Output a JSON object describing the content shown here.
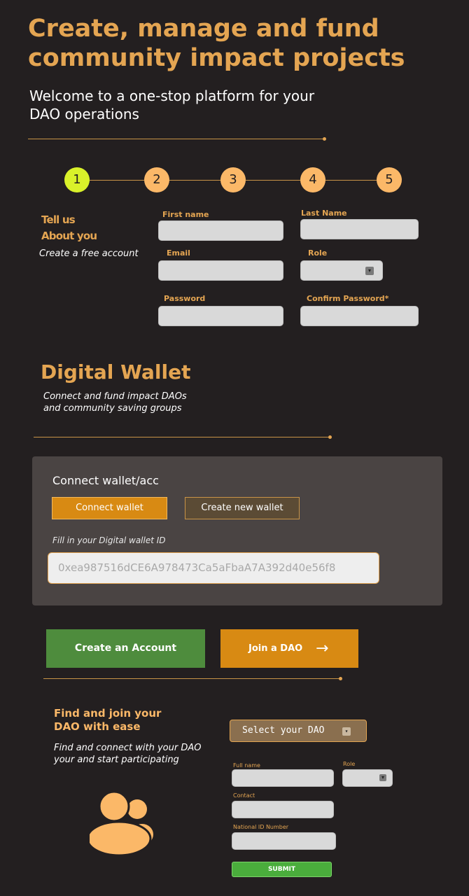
{
  "hero": {
    "title": "Create, manage and fund community impact projects",
    "subtitle": "Welcome to a one-stop platform for your DAO operations"
  },
  "steps": [
    "1",
    "2",
    "3",
    "4",
    "5"
  ],
  "signup": {
    "heading_line1": "Tell us",
    "heading_line2": "About you",
    "caption": "Create a free account",
    "fields": {
      "first_name": "First name",
      "last_name": "Last Name",
      "email": "Email",
      "role": "Role",
      "password": "Password",
      "confirm_password": "Confirm Password*"
    }
  },
  "wallet": {
    "title": "Digital Wallet",
    "caption_line1": "Connect and fund impact DAOs",
    "caption_line2": "and community saving groups",
    "panel_title": "Connect wallet/acc",
    "connect_label": "Connect wallet",
    "create_label": "Create new wallet",
    "id_label": "Fill in your Digital wallet ID",
    "id_placeholder": "0xea987516dCE6A978473Ca5aFbaA7A392d40e56f8"
  },
  "actions": {
    "create_account": "Create an Account",
    "join_dao": "Join a DAO",
    "join_arrow": "→"
  },
  "join": {
    "title_line1": "Find and join your",
    "title_line2": "DAO with ease",
    "caption_line1": "Find and connect with your DAO",
    "caption_line2": "your and start participating",
    "select_value": "Select your DAO",
    "labels": {
      "full_name": "Full name",
      "role": "Role",
      "contact": "Contact",
      "national_id": "National ID Number"
    },
    "submit_label": "SUBMIT"
  },
  "icons": {
    "select_arrow": "chevron-down-icon",
    "group": "users-group-icon"
  },
  "colors": {
    "background": "#231f20",
    "accent": "#e4a552",
    "step_active": "#d9f12a",
    "step": "#fbb868",
    "orange_button": "#d88a13",
    "green_button": "#4e8c3d"
  }
}
